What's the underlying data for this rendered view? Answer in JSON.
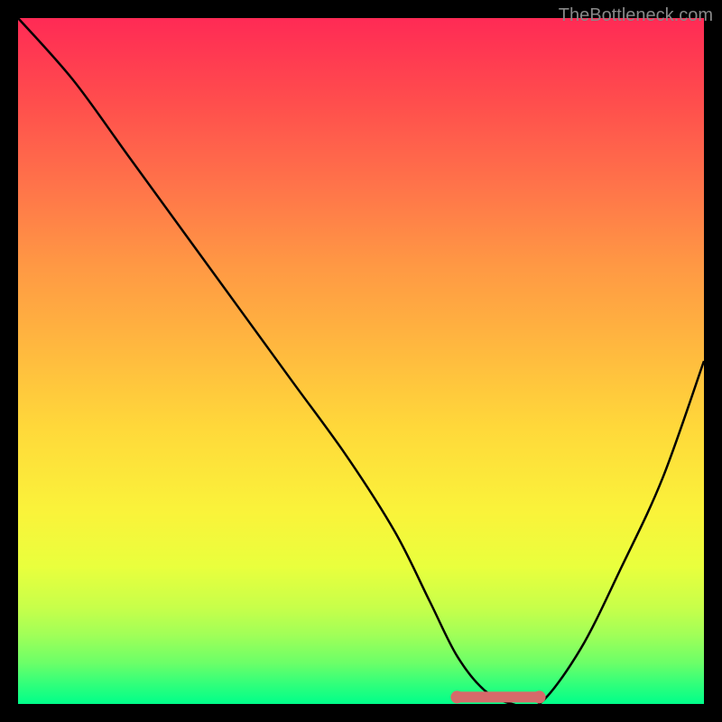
{
  "watermark": "TheBottleneck.com",
  "chart_data": {
    "type": "line",
    "title": "",
    "xlabel": "",
    "ylabel": "",
    "xlim": [
      0,
      100
    ],
    "ylim": [
      0,
      100
    ],
    "series": [
      {
        "name": "bottleneck-curve",
        "x": [
          0,
          8,
          16,
          24,
          32,
          40,
          48,
          55,
          60,
          64,
          68,
          72,
          76,
          82,
          88,
          94,
          100
        ],
        "values": [
          100,
          91,
          80,
          69,
          58,
          47,
          36,
          25,
          15,
          7,
          2,
          0,
          0,
          8,
          20,
          33,
          50
        ]
      }
    ],
    "optimal_range": {
      "x_start": 64,
      "x_end": 76,
      "y": 1
    },
    "background_gradient": {
      "top": "#ff2a55",
      "bottom": "#00ff8a"
    }
  }
}
